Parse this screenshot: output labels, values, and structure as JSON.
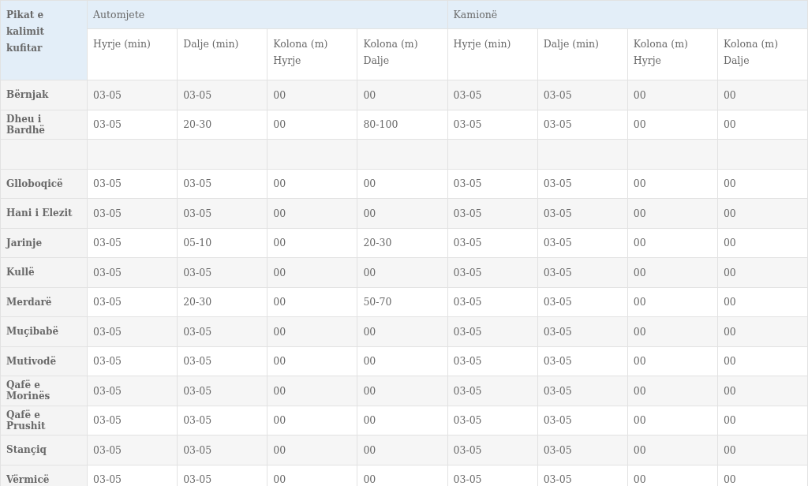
{
  "table": {
    "corner_header": "Pikat e kalimit kufitar",
    "groups": [
      "Automjete",
      "Kamionë"
    ],
    "columns": [
      "Hyrje (min)",
      "Dalje (min)",
      "Kolona (m) Hyrje",
      "Kolona (m) Dalje",
      "Hyrje (min)",
      "Dalje (min)",
      "Kolona (m) Hyrje",
      "Kolona (m) Dalje"
    ],
    "rows": [
      {
        "kind": "data",
        "name": "Bërnjak",
        "cells": [
          "03-05",
          "03-05",
          "00",
          "00",
          "03-05",
          "03-05",
          "00",
          "00"
        ]
      },
      {
        "kind": "data",
        "name": "Dheu i Bardhë",
        "cells": [
          "03-05",
          "20-30",
          "00",
          "80-100",
          "03-05",
          "03-05",
          "00",
          "00"
        ]
      },
      {
        "kind": "spacer"
      },
      {
        "kind": "data",
        "name": "Glloboqicë",
        "cells": [
          "03-05",
          "03-05",
          "00",
          "00",
          "03-05",
          "03-05",
          "00",
          "00"
        ]
      },
      {
        "kind": "data",
        "name": "Hani i Elezit",
        "cells": [
          "03-05",
          "03-05",
          "00",
          "00",
          "03-05",
          "03-05",
          "00",
          "00"
        ]
      },
      {
        "kind": "data",
        "name": "Jarinje",
        "cells": [
          "03-05",
          "05-10",
          "00",
          "20-30",
          "03-05",
          "03-05",
          "00",
          "00"
        ]
      },
      {
        "kind": "data",
        "name": "Kullë",
        "cells": [
          "03-05",
          "03-05",
          "00",
          "00",
          "03-05",
          "03-05",
          "00",
          "00"
        ]
      },
      {
        "kind": "data",
        "name": "Merdarë",
        "cells": [
          "03-05",
          "20-30",
          "00",
          "50-70",
          "03-05",
          "03-05",
          "00",
          "00"
        ]
      },
      {
        "kind": "data",
        "name": "Muçibabë",
        "cells": [
          "03-05",
          "03-05",
          "00",
          "00",
          "03-05",
          "03-05",
          "00",
          "00"
        ]
      },
      {
        "kind": "data",
        "name": "Mutivodë",
        "cells": [
          "03-05",
          "03-05",
          "00",
          "00",
          "03-05",
          "03-05",
          "00",
          "00"
        ]
      },
      {
        "kind": "data",
        "name": "Qafë e Morinës",
        "cells": [
          "03-05",
          "03-05",
          "00",
          "00",
          "03-05",
          "03-05",
          "00",
          "00"
        ]
      },
      {
        "kind": "data",
        "name": "Qafë e Prushit",
        "cells": [
          "03-05",
          "03-05",
          "00",
          "00",
          "03-05",
          "03-05",
          "00",
          "00"
        ]
      },
      {
        "kind": "data",
        "name": "Stançiq",
        "cells": [
          "03-05",
          "03-05",
          "00",
          "00",
          "03-05",
          "03-05",
          "00",
          "00"
        ]
      },
      {
        "kind": "data",
        "name": "Vërmicë",
        "cells": [
          "03-05",
          "03-05",
          "00",
          "00",
          "03-05",
          "03-05",
          "00",
          "00"
        ]
      }
    ]
  }
}
